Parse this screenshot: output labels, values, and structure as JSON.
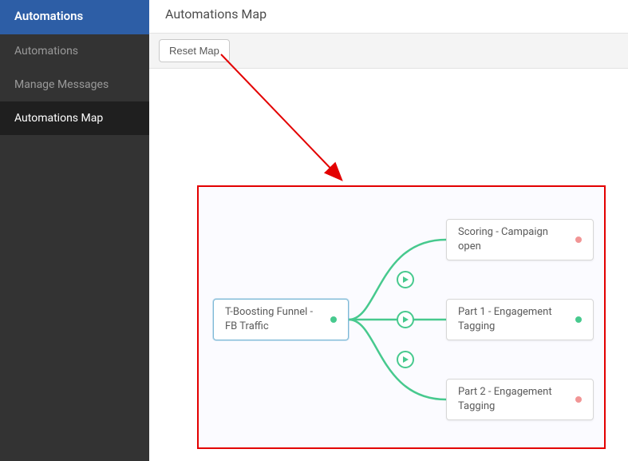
{
  "sidebar": {
    "header": "Automations",
    "items": [
      {
        "label": "Automations",
        "active": false
      },
      {
        "label": "Manage Messages",
        "active": false
      },
      {
        "label": "Automations Map",
        "active": true
      }
    ]
  },
  "page": {
    "title": "Automations Map"
  },
  "toolbar": {
    "reset_label": "Reset Map"
  },
  "map": {
    "root": {
      "label": "T-Boosting Funnel - FB Traffic",
      "status": "green"
    },
    "children": [
      {
        "label": "Scoring - Campaign open",
        "status": "red"
      },
      {
        "label": "Part 1 - Engagement Tagging",
        "status": "green"
      },
      {
        "label": "Part 2 - Engagement Tagging",
        "status": "red"
      }
    ]
  },
  "colors": {
    "sidebar_bg": "#333333",
    "sidebar_active_bg": "#1f1f1f",
    "brand_blue": "#2d5ea6",
    "connector_green": "#47c98e",
    "annotation_red": "#e30000"
  },
  "icons": {
    "play": "play-icon",
    "arrow": "arrow-icon"
  }
}
